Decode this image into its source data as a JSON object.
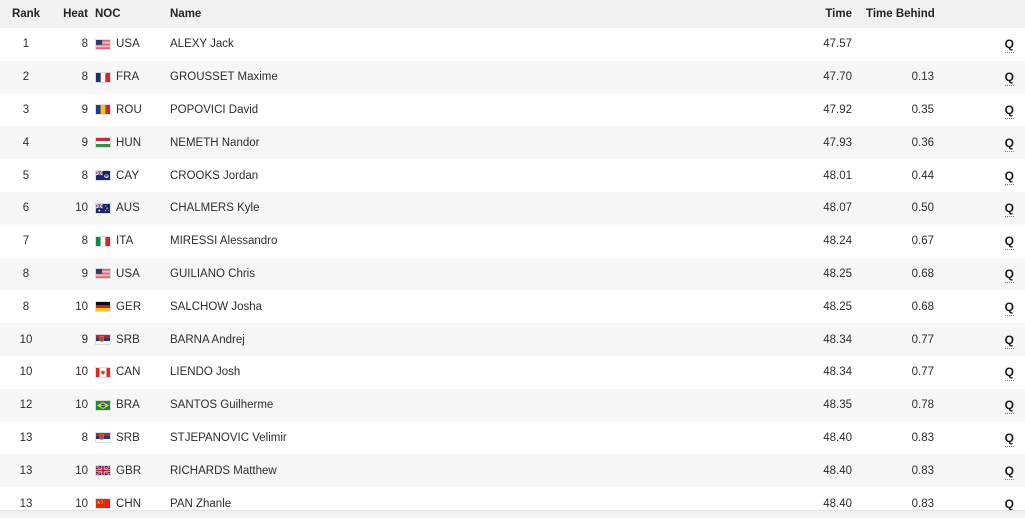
{
  "table": {
    "columns": {
      "rank": "Rank",
      "heat": "Heat",
      "noc": "NOC",
      "name": "Name",
      "time": "Time",
      "time_behind": "Time Behind",
      "qualification": ""
    },
    "qualification_mark": "Q",
    "rows": [
      {
        "rank": "1",
        "heat": "8",
        "noc": "USA",
        "flag": "flag-usa",
        "name": "ALEXY Jack",
        "time": "47.57",
        "behind": "",
        "qual": "Q"
      },
      {
        "rank": "2",
        "heat": "8",
        "noc": "FRA",
        "flag": "flag-fra",
        "name": "GROUSSET Maxime",
        "time": "47.70",
        "behind": "0.13",
        "qual": "Q"
      },
      {
        "rank": "3",
        "heat": "9",
        "noc": "ROU",
        "flag": "flag-rou",
        "name": "POPOVICI David",
        "time": "47.92",
        "behind": "0.35",
        "qual": "Q"
      },
      {
        "rank": "4",
        "heat": "9",
        "noc": "HUN",
        "flag": "flag-hun",
        "name": "NEMETH Nandor",
        "time": "47.93",
        "behind": "0.36",
        "qual": "Q"
      },
      {
        "rank": "5",
        "heat": "8",
        "noc": "CAY",
        "flag": "flag-cay",
        "name": "CROOKS Jordan",
        "time": "48.01",
        "behind": "0.44",
        "qual": "Q"
      },
      {
        "rank": "6",
        "heat": "10",
        "noc": "AUS",
        "flag": "flag-aus",
        "name": "CHALMERS Kyle",
        "time": "48.07",
        "behind": "0.50",
        "qual": "Q"
      },
      {
        "rank": "7",
        "heat": "8",
        "noc": "ITA",
        "flag": "flag-ita",
        "name": "MIRESSI Alessandro",
        "time": "48.24",
        "behind": "0.67",
        "qual": "Q"
      },
      {
        "rank": "8",
        "heat": "9",
        "noc": "USA",
        "flag": "flag-usa",
        "name": "GUILIANO Chris",
        "time": "48.25",
        "behind": "0.68",
        "qual": "Q"
      },
      {
        "rank": "8",
        "heat": "10",
        "noc": "GER",
        "flag": "flag-ger",
        "name": "SALCHOW Josha",
        "time": "48.25",
        "behind": "0.68",
        "qual": "Q"
      },
      {
        "rank": "10",
        "heat": "9",
        "noc": "SRB",
        "flag": "flag-srb",
        "name": "BARNA Andrej",
        "time": "48.34",
        "behind": "0.77",
        "qual": "Q"
      },
      {
        "rank": "10",
        "heat": "10",
        "noc": "CAN",
        "flag": "flag-can",
        "name": "LIENDO Josh",
        "time": "48.34",
        "behind": "0.77",
        "qual": "Q"
      },
      {
        "rank": "12",
        "heat": "10",
        "noc": "BRA",
        "flag": "flag-bra",
        "name": "SANTOS Guilherme",
        "time": "48.35",
        "behind": "0.78",
        "qual": "Q"
      },
      {
        "rank": "13",
        "heat": "8",
        "noc": "SRB",
        "flag": "flag-srb",
        "name": "STJEPANOVIC Velimir",
        "time": "48.40",
        "behind": "0.83",
        "qual": "Q"
      },
      {
        "rank": "13",
        "heat": "10",
        "noc": "GBR",
        "flag": "flag-gbr",
        "name": "RICHARDS Matthew",
        "time": "48.40",
        "behind": "0.83",
        "qual": "Q"
      },
      {
        "rank": "13",
        "heat": "10",
        "noc": "CHN",
        "flag": "flag-chn",
        "name": "PAN Zhanle",
        "time": "48.40",
        "behind": "0.83",
        "qual": "Q"
      }
    ]
  },
  "colors": {
    "header_bg": "#f2f2f2",
    "row_alt_bg": "#f7f7f7",
    "row_bg": "#ffffff",
    "text": "#2d2d2d"
  }
}
